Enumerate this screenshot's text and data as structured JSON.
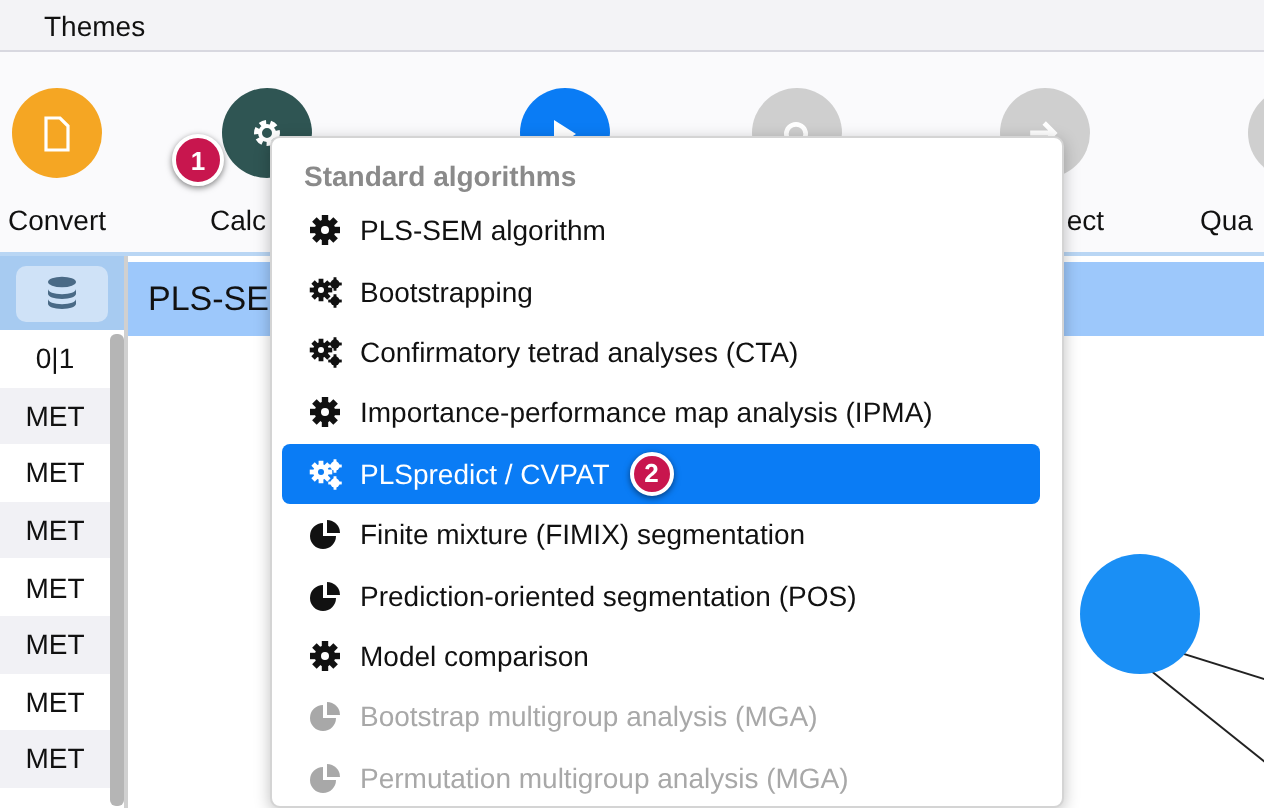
{
  "menubar": {
    "items": [
      "Themes"
    ]
  },
  "toolbar": {
    "buttons": [
      {
        "label": "Convert",
        "kind": "document",
        "color": "#f5a623"
      },
      {
        "label": "Calc",
        "kind": "gear",
        "color": "#2f5553",
        "badge": "1"
      },
      {
        "kind": "play",
        "color": "#0a7cf5"
      },
      {
        "kind": "search",
        "color": "#cfcfcf"
      },
      {
        "label": "ect",
        "kind": "arrow",
        "color": "#cfcfcf"
      },
      {
        "label": "Qua",
        "kind": "none",
        "color": "#cfcfcf"
      }
    ]
  },
  "data_panel": {
    "rows": [
      "0|1",
      "MET",
      "MET",
      "MET",
      "MET",
      "MET",
      "MET",
      "MET"
    ]
  },
  "editor": {
    "tab": "PLS-SE"
  },
  "menu": {
    "header": "Standard algorithms",
    "items": [
      {
        "label": "PLS-SEM algorithm",
        "kind": "gear",
        "selected": false,
        "disabled": false
      },
      {
        "label": "Bootstrapping",
        "kind": "gears",
        "selected": false,
        "disabled": false
      },
      {
        "label": "Confirmatory tetrad analyses (CTA)",
        "kind": "gears",
        "selected": false,
        "disabled": false
      },
      {
        "label": "Importance-performance map analysis (IPMA)",
        "kind": "gear",
        "selected": false,
        "disabled": false
      },
      {
        "label": "PLSpredict / CVPAT",
        "kind": "gears",
        "selected": true,
        "disabled": false,
        "badge": "2"
      },
      {
        "label": "Finite mixture (FIMIX) segmentation",
        "kind": "pie",
        "selected": false,
        "disabled": false
      },
      {
        "label": "Prediction-oriented segmentation (POS)",
        "kind": "pie",
        "selected": false,
        "disabled": false
      },
      {
        "label": "Model comparison",
        "kind": "gear",
        "selected": false,
        "disabled": false
      },
      {
        "label": "Bootstrap multigroup analysis (MGA)",
        "kind": "pie",
        "selected": false,
        "disabled": true
      },
      {
        "label": "Permutation multigroup analysis (MGA)",
        "kind": "pie",
        "selected": false,
        "disabled": true
      }
    ]
  }
}
